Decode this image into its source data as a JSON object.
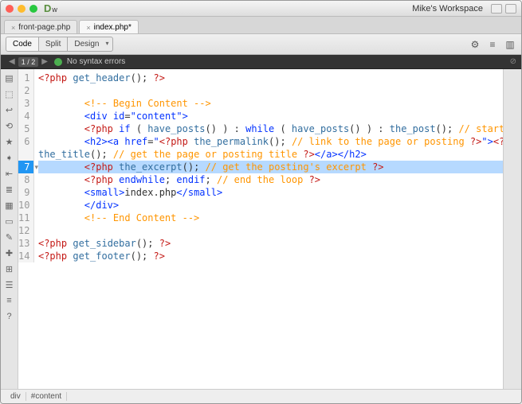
{
  "app": {
    "logo_main": "D",
    "logo_sub": "w",
    "workspace": "Mike's Workspace"
  },
  "tabs": [
    {
      "label": "front-page.php",
      "active": false
    },
    {
      "label": "index.php*",
      "active": true
    }
  ],
  "view_buttons": {
    "code": "Code",
    "split": "Split",
    "design": "Design"
  },
  "error_bar": {
    "nav": "1 / 2",
    "message": "No syntax errors"
  },
  "status": {
    "tag": "div",
    "selector": "#content"
  },
  "tool_icons": [
    "file",
    "dom",
    "wrap",
    "format",
    "star",
    "indent",
    "outdent",
    "lines",
    "grid",
    "box",
    "edit",
    "pin",
    "css",
    "list",
    "bars",
    "help"
  ],
  "right_icons": [
    "gear",
    "sliders",
    "panel"
  ],
  "code_lines": [
    {
      "n": 1,
      "i": 0,
      "seg": [
        [
          "php",
          "<?php"
        ],
        [
          "txt",
          " "
        ],
        [
          "fn",
          "get_header"
        ],
        [
          "txt",
          "()"
        ],
        [
          "txt",
          "; "
        ],
        [
          "php",
          "?>"
        ]
      ]
    },
    {
      "n": 2,
      "i": 0,
      "seg": []
    },
    {
      "n": 3,
      "i": 2,
      "seg": [
        [
          "cmt",
          "<!-- Begin Content -->"
        ]
      ]
    },
    {
      "n": 4,
      "i": 2,
      "seg": [
        [
          "tag",
          "<div"
        ],
        [
          "txt",
          " "
        ],
        [
          "kw",
          "id"
        ],
        [
          "txt",
          "="
        ],
        [
          "str",
          "\"content\""
        ],
        [
          "tag",
          ">"
        ]
      ]
    },
    {
      "n": 5,
      "i": 2,
      "seg": [
        [
          "php",
          "<?php"
        ],
        [
          "txt",
          " "
        ],
        [
          "kw",
          "if"
        ],
        [
          "txt",
          " ( "
        ],
        [
          "fn",
          "have_posts"
        ],
        [
          "txt",
          "() ) : "
        ],
        [
          "kw",
          "while"
        ],
        [
          "txt",
          " ( "
        ],
        [
          "fn",
          "have_posts"
        ],
        [
          "txt",
          "() ) : "
        ],
        [
          "fn",
          "the_post"
        ],
        [
          "txt",
          "(); "
        ],
        [
          "cmt",
          "// start the loop"
        ],
        [
          "txt",
          " "
        ],
        [
          "php",
          "?>"
        ]
      ]
    },
    {
      "n": 6,
      "i": 2,
      "seg": [
        [
          "tag",
          "<h2><a"
        ],
        [
          "txt",
          " "
        ],
        [
          "kw",
          "href"
        ],
        [
          "txt",
          "="
        ],
        [
          "str",
          "\""
        ],
        [
          "php",
          "<?php"
        ],
        [
          "txt",
          " "
        ],
        [
          "fn",
          "the_permalink"
        ],
        [
          "txt",
          "(); "
        ],
        [
          "cmt",
          "// link to the page or posting"
        ],
        [
          "txt",
          " "
        ],
        [
          "php",
          "?>"
        ],
        [
          "str",
          "\""
        ],
        [
          "tag",
          ">"
        ],
        [
          "php",
          "<?php"
        ]
      ]
    },
    {
      "n": 0,
      "cont": true,
      "i": 0,
      "seg": [
        [
          "fn",
          "the_title"
        ],
        [
          "txt",
          "(); "
        ],
        [
          "cmt",
          "// get the page or posting title"
        ],
        [
          "txt",
          " "
        ],
        [
          "php",
          "?>"
        ],
        [
          "tag",
          "</a></h2>"
        ]
      ]
    },
    {
      "n": 7,
      "hl": true,
      "fold": "▾",
      "i": 2,
      "seg": [
        [
          "php",
          "<?php"
        ],
        [
          "txt",
          " "
        ],
        [
          "fn",
          "the_excerpt"
        ],
        [
          "txt",
          "(); "
        ],
        [
          "cmt",
          "// get the posting's excerpt"
        ],
        [
          "txt",
          " "
        ],
        [
          "php",
          "?>"
        ]
      ]
    },
    {
      "n": 8,
      "i": 2,
      "seg": [
        [
          "php",
          "<?php"
        ],
        [
          "txt",
          " "
        ],
        [
          "kw",
          "endwhile"
        ],
        [
          "txt",
          "; "
        ],
        [
          "kw",
          "endif"
        ],
        [
          "txt",
          "; "
        ],
        [
          "cmt",
          "// end the loop"
        ],
        [
          "txt",
          " "
        ],
        [
          "php",
          "?>"
        ]
      ]
    },
    {
      "n": 9,
      "i": 2,
      "seg": [
        [
          "tag",
          "<small>"
        ],
        [
          "txt",
          "index.php"
        ],
        [
          "tag",
          "</small>"
        ]
      ]
    },
    {
      "n": 10,
      "i": 2,
      "seg": [
        [
          "tag",
          "</div>"
        ]
      ]
    },
    {
      "n": 11,
      "i": 2,
      "seg": [
        [
          "cmt",
          "<!-- End Content -->"
        ]
      ]
    },
    {
      "n": 12,
      "i": 0,
      "seg": []
    },
    {
      "n": 13,
      "i": 0,
      "seg": [
        [
          "php",
          "<?php"
        ],
        [
          "txt",
          " "
        ],
        [
          "fn",
          "get_sidebar"
        ],
        [
          "txt",
          "(); "
        ],
        [
          "php",
          "?>"
        ]
      ]
    },
    {
      "n": 14,
      "i": 0,
      "seg": [
        [
          "php",
          "<?php"
        ],
        [
          "txt",
          " "
        ],
        [
          "fn",
          "get_footer"
        ],
        [
          "txt",
          "(); "
        ],
        [
          "php",
          "?>"
        ]
      ]
    }
  ]
}
